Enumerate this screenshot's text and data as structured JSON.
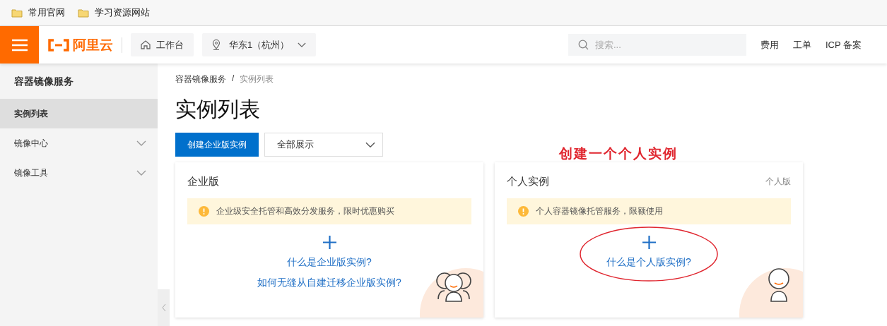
{
  "bookmarks": [
    {
      "label": "常用官网"
    },
    {
      "label": "学习资源网站"
    }
  ],
  "topbar": {
    "logo": "阿里云",
    "workbench": "工作台",
    "region": "华东1（杭州）",
    "search": {
      "placeholder": "搜索..."
    },
    "links": [
      "费用",
      "工单",
      "ICP 备案"
    ]
  },
  "sidebar": {
    "title": "容器镜像服务",
    "items": [
      {
        "label": "实例列表",
        "selected": true,
        "kind": "link"
      },
      {
        "label": "镜像中心",
        "selected": false,
        "kind": "group"
      },
      {
        "label": "镜像工具",
        "selected": false,
        "kind": "group"
      }
    ]
  },
  "breadcrumb": [
    "容器镜像服务",
    "/",
    "实例列表"
  ],
  "page_title": "实例列表",
  "create_button": "创建企业版实例",
  "filter": {
    "value": "全部展示"
  },
  "annotation": "创建一个个人实例",
  "cards": [
    {
      "title": "企业版",
      "notice": "企业级安全托管和高效分发服务，限时优惠购买",
      "links": [
        "什么是企业版实例?",
        "如何无缝从自建迁移企业版实例?"
      ],
      "kind": "group",
      "circled": false
    },
    {
      "title": "个人实例",
      "tag": "个人版",
      "notice": "个人容器镜像托管服务，限额使用",
      "links": [
        "什么是个人版实例?"
      ],
      "kind": "single",
      "circled": true
    }
  ]
}
